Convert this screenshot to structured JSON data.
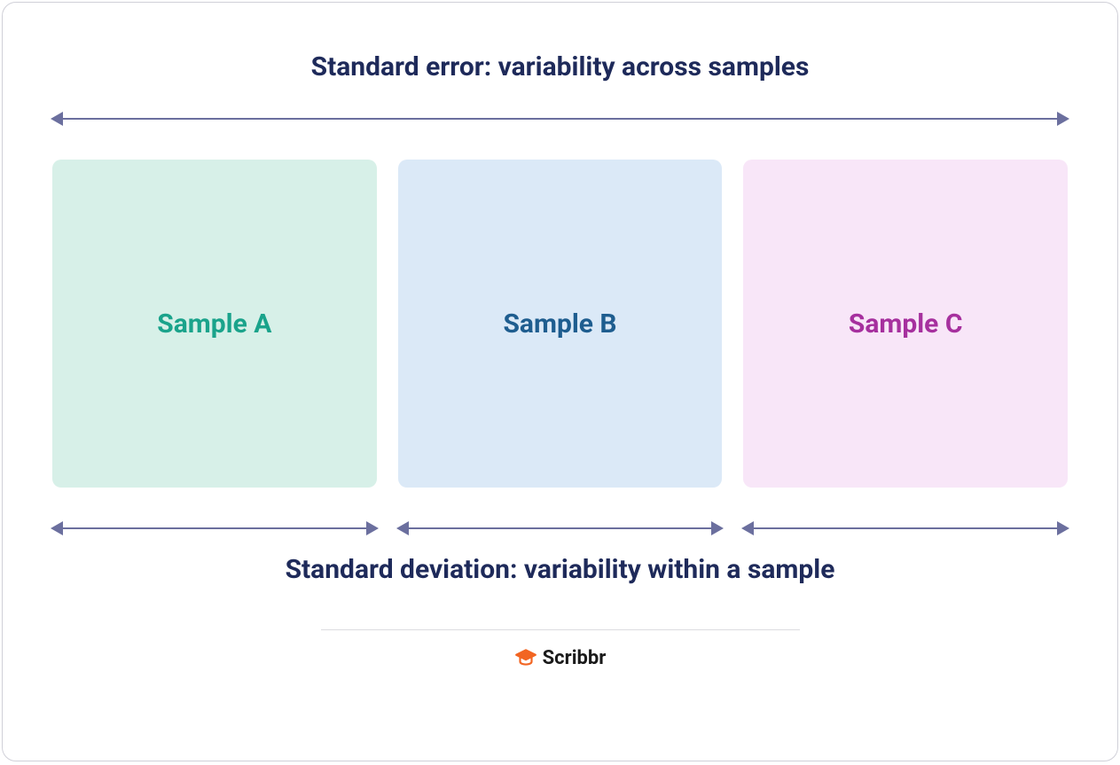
{
  "titleTop": "Standard error: variability across samples",
  "titleBottom": "Standard deviation: variability within a sample",
  "samples": {
    "a": {
      "label": "Sample A",
      "bg": "#d7f0e8",
      "color": "#1aa38b"
    },
    "b": {
      "label": "Sample B",
      "bg": "#dbe9f7",
      "color": "#1e5d8f"
    },
    "c": {
      "label": "Sample C",
      "bg": "#f8e6f8",
      "color": "#a6309e"
    }
  },
  "brand": {
    "name": "Scribbr",
    "iconColor": "#f26522"
  },
  "colors": {
    "titleText": "#1e2a5a",
    "arrow": "#6b6f9e",
    "border": "#d0d0d8"
  }
}
